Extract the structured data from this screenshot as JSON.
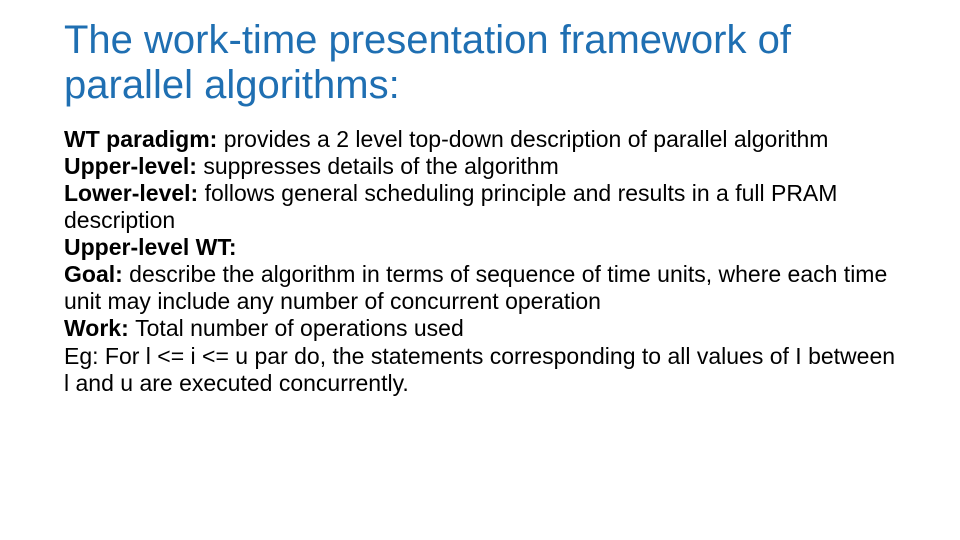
{
  "slide": {
    "title": "The work-time presentation framework of parallel algorithms:",
    "items": {
      "wt_paradigm": {
        "label": "WT paradigm: ",
        "text": "provides a 2 level top-down description of parallel algorithm"
      },
      "upper_level": {
        "label": "Upper-level: ",
        "text": "suppresses details of the algorithm"
      },
      "lower_level": {
        "label": "Lower-level: ",
        "text": "follows general scheduling principle and results in a full PRAM description"
      },
      "upper_level_wt": {
        "label": "Upper-level WT:",
        "text": ""
      },
      "goal": {
        "label": "Goal: ",
        "text": "describe the algorithm in terms of sequence of time units, where each time unit may include any number of concurrent operation"
      },
      "work": {
        "label": "Work: ",
        "text": "Total number of operations used"
      },
      "eg": {
        "label": "",
        "text": "Eg: For l <= i <= u par do, the statements corresponding to all values of I between l and u are executed concurrently."
      }
    }
  }
}
